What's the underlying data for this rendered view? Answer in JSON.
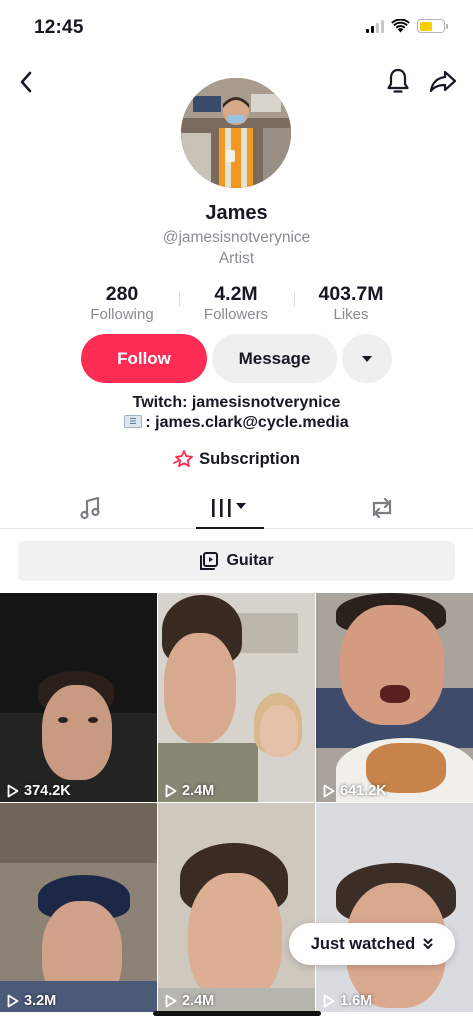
{
  "status_bar": {
    "time": "12:45",
    "battery_color": "#f7ce00"
  },
  "nav": {
    "back_icon": "chevron-left-icon",
    "bell_icon": "bell-icon",
    "share_icon": "share-arrow-icon"
  },
  "profile": {
    "name": "James",
    "handle": "@jamesisnotverynice",
    "category": "Artist",
    "avatar_icon": "profile-photo"
  },
  "stats": [
    {
      "value": "280",
      "label": "Following"
    },
    {
      "value": "4.2M",
      "label": "Followers"
    },
    {
      "value": "403.7M",
      "label": "Likes"
    }
  ],
  "actions": {
    "follow_label": "Follow",
    "message_label": "Message",
    "follow_color": "#fe2c55"
  },
  "bio": {
    "line1": "Twitch: jamesisnotverynice",
    "line2": ": james.clark@cycle.media"
  },
  "subscription": {
    "label": "Subscription",
    "icon": "star-badge-icon",
    "accent": "#fe2c55"
  },
  "tabs": [
    {
      "icon": "music-note-icon",
      "selected": false
    },
    {
      "icon": "grid-videos-icon",
      "selected": true
    },
    {
      "icon": "repost-icon",
      "selected": false
    }
  ],
  "playlist": {
    "label": "Guitar",
    "icon": "playlist-icon"
  },
  "videos": [
    {
      "views": "374.2K"
    },
    {
      "views": "2.4M"
    },
    {
      "views": "641.2K"
    },
    {
      "views": "3.2M"
    },
    {
      "views": "2.4M"
    },
    {
      "views": "1.6M"
    }
  ],
  "just_watched": {
    "label": "Just watched"
  }
}
